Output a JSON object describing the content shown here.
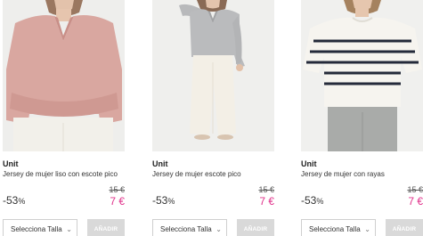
{
  "products": [
    {
      "brand": "Unit",
      "name": "Jersey de mujer liso con escote pico",
      "discount_value": "-53",
      "discount_unit": "%",
      "old_price": "15 €",
      "new_price": "7 €",
      "size_select": "Selecciona Talla",
      "add_label": "AÑADIR"
    },
    {
      "brand": "Unit",
      "name": "Jersey de mujer escote pico",
      "discount_value": "-53",
      "discount_unit": "%",
      "old_price": "15 €",
      "new_price": "7 €",
      "size_select": "Selecciona Talla",
      "add_label": "AÑADIR"
    },
    {
      "brand": "Unit",
      "name": "Jersey de mujer con rayas",
      "discount_value": "-53",
      "discount_unit": "%",
      "old_price": "15 €",
      "new_price": "7 €",
      "size_select": "Selecciona Talla",
      "add_label": "AÑADIR"
    }
  ],
  "colors": {
    "sale_price": "#e0318b",
    "add_button_bg": "#d9d9d9",
    "photo_bg": "#efefed"
  },
  "icons": {
    "select_chevron": "chevron-down-icon"
  }
}
